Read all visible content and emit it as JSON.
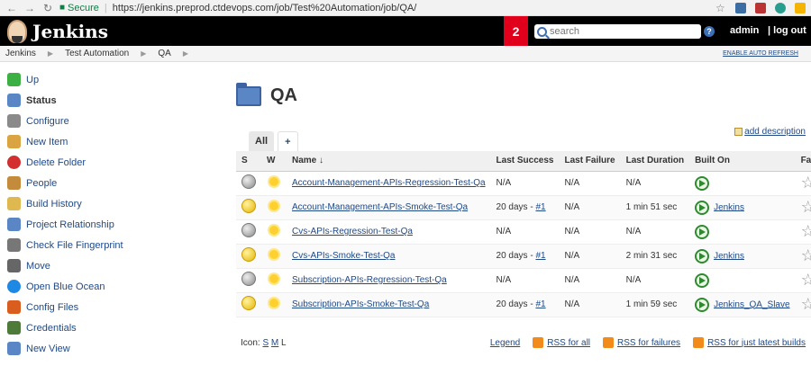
{
  "browser": {
    "secure_label": "Secure",
    "url": "https://jenkins.preprod.ctdevops.com/job/Test%20Automation/job/QA/"
  },
  "header": {
    "logo_text": "Jenkins",
    "notification_count": "2",
    "search_placeholder": "search",
    "help_label": "?",
    "user": "admin",
    "logout": "| log out"
  },
  "breadcrumb": {
    "items": [
      "Jenkins",
      "Test Automation",
      "QA"
    ],
    "auto_refresh": "ENABLE AUTO REFRESH"
  },
  "sidebar": {
    "items": [
      {
        "label": "Up",
        "icon": "up-arrow-icon",
        "color": "#3cb043"
      },
      {
        "label": "Status",
        "icon": "search-icon",
        "color": "#5a86c5"
      },
      {
        "label": "Configure",
        "icon": "wrench-icon",
        "color": "#8a8a8a"
      },
      {
        "label": "New Item",
        "icon": "package-icon",
        "color": "#d9a441"
      },
      {
        "label": "Delete Folder",
        "icon": "no-entry-icon",
        "color": "#d32f2f"
      },
      {
        "label": "People",
        "icon": "people-icon",
        "color": "#c58b3c"
      },
      {
        "label": "Build History",
        "icon": "notepad-icon",
        "color": "#e0b850"
      },
      {
        "label": "Project Relationship",
        "icon": "search-icon",
        "color": "#5a86c5"
      },
      {
        "label": "Check File Fingerprint",
        "icon": "fingerprint-icon",
        "color": "#777777"
      },
      {
        "label": "Move",
        "icon": "move-icon",
        "color": "#666666"
      },
      {
        "label": "Open Blue Ocean",
        "icon": "blue-ocean-icon",
        "color": "#1e88e5"
      },
      {
        "label": "Config Files",
        "icon": "config-files-icon",
        "color": "#d95d1e"
      },
      {
        "label": "Credentials",
        "icon": "credentials-icon",
        "color": "#4e7a3a"
      },
      {
        "label": "New View",
        "icon": "folder-icon",
        "color": "#5a86c5"
      }
    ]
  },
  "main": {
    "title": "QA",
    "add_description": "add description",
    "tabs": [
      "All",
      "+"
    ],
    "columns": [
      "S",
      "W",
      "Name ↓",
      "Last Success",
      "Last Failure",
      "Last Duration",
      "Built On",
      "Fav"
    ],
    "jobs": [
      {
        "status": "grey",
        "name": "Account-Management-APIs-Regression-Test-Qa",
        "last_success": "N/A",
        "run": "",
        "last_failure": "N/A",
        "duration": "N/A",
        "built_on": ""
      },
      {
        "status": "blue",
        "name": "Account-Management-APIs-Smoke-Test-Qa",
        "last_success": "20 days - ",
        "run": "#1",
        "last_failure": "N/A",
        "duration": "1 min 51 sec",
        "built_on": "Jenkins"
      },
      {
        "status": "grey",
        "name": "Cvs-APIs-Regression-Test-Qa",
        "last_success": "N/A",
        "run": "",
        "last_failure": "N/A",
        "duration": "N/A",
        "built_on": ""
      },
      {
        "status": "blue",
        "name": "Cvs-APIs-Smoke-Test-Qa",
        "last_success": "20 days - ",
        "run": "#1",
        "last_failure": "N/A",
        "duration": "2 min 31 sec",
        "built_on": "Jenkins"
      },
      {
        "status": "grey",
        "name": "Subscription-APIs-Regression-Test-Qa",
        "last_success": "N/A",
        "run": "",
        "last_failure": "N/A",
        "duration": "N/A",
        "built_on": ""
      },
      {
        "status": "blue",
        "name": "Subscription-APIs-Smoke-Test-Qa",
        "last_success": "20 days - ",
        "run": "#1",
        "last_failure": "N/A",
        "duration": "1 min 59 sec",
        "built_on": "Jenkins_QA_Slave"
      }
    ],
    "icon_size_label": "Icon:",
    "icon_sizes": [
      "S",
      "M",
      "L"
    ],
    "footer_links": {
      "legend": "Legend",
      "rss_all": "RSS for all",
      "rss_failures": "RSS for failures",
      "rss_latest": "RSS for just latest builds"
    }
  }
}
